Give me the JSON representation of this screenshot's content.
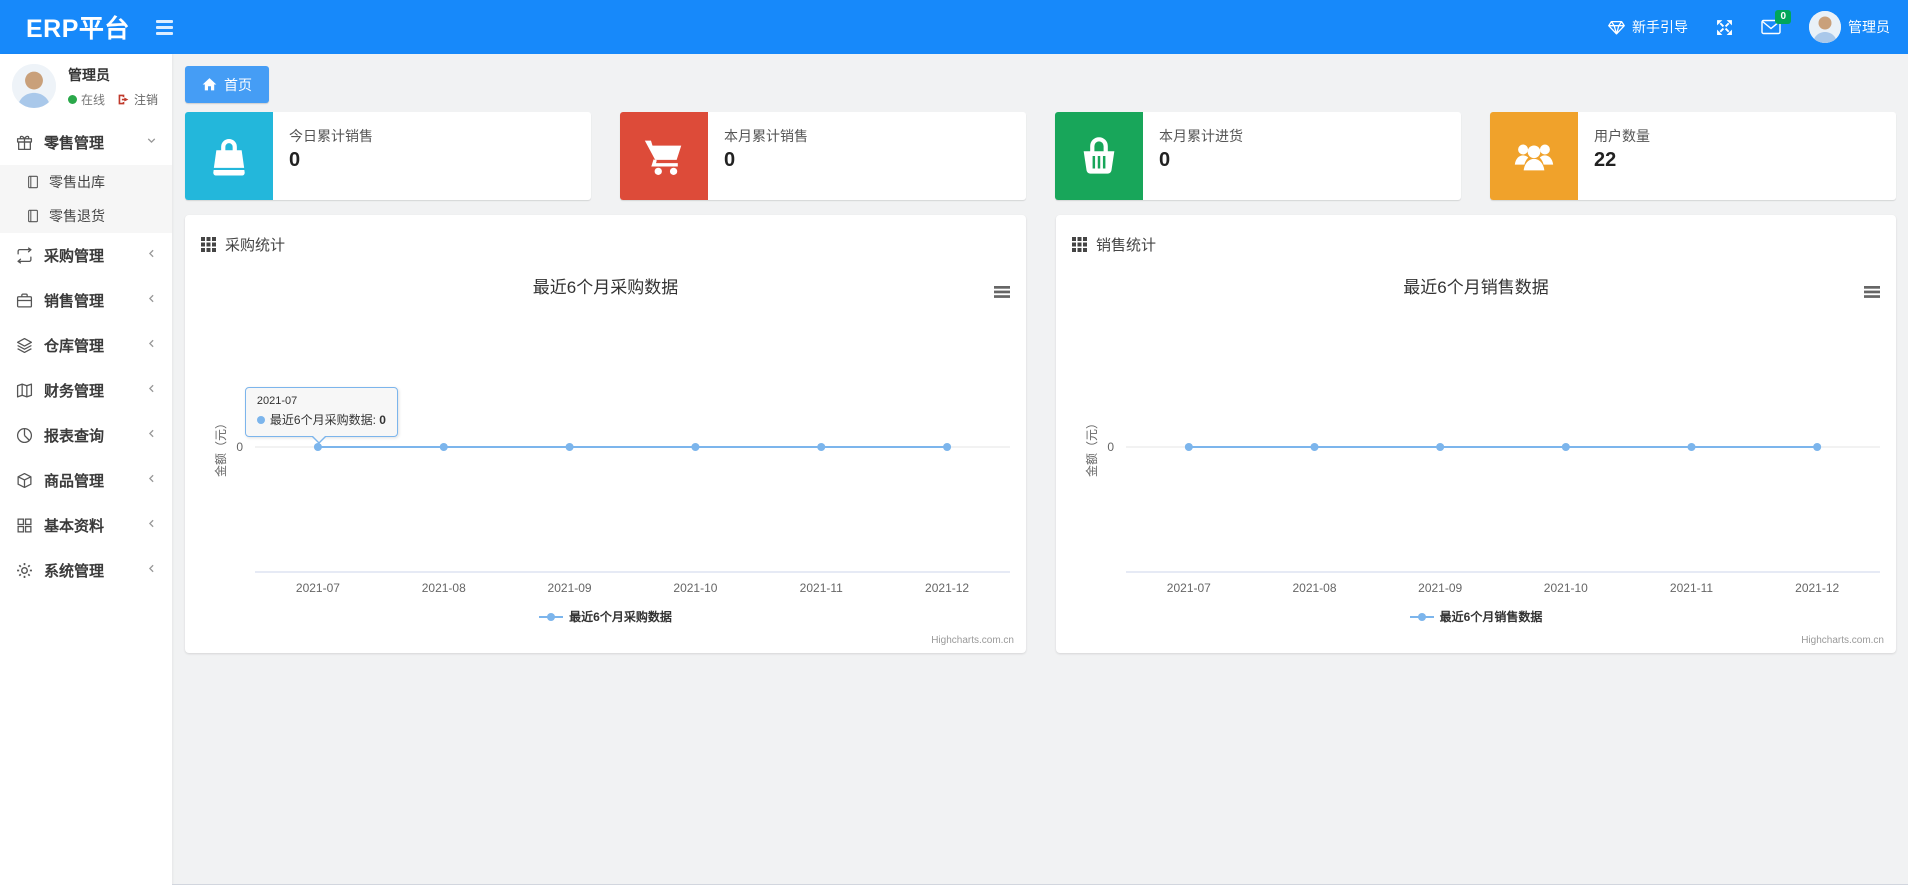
{
  "navbar": {
    "brand": "ERP平台",
    "guide_label": "新手引导",
    "mail_badge": "0",
    "user_label": "管理员",
    "icons": [
      "menu-icon",
      "gem-icon",
      "fullscreen-icon",
      "envelope-icon",
      "avatar"
    ]
  },
  "sidebar": {
    "user": {
      "name": "管理员",
      "status": "在线",
      "logout": "注销"
    },
    "items": [
      {
        "label": "零售管理",
        "icon": "gift-icon",
        "expanded": true,
        "children": [
          {
            "label": "零售出库",
            "icon": "journal-icon"
          },
          {
            "label": "零售退货",
            "icon": "journal-icon"
          }
        ]
      },
      {
        "label": "采购管理",
        "icon": "loop-icon"
      },
      {
        "label": "销售管理",
        "icon": "briefcase-icon"
      },
      {
        "label": "仓库管理",
        "icon": "layers-icon"
      },
      {
        "label": "财务管理",
        "icon": "map-icon"
      },
      {
        "label": "报表查询",
        "icon": "pie-chart-icon"
      },
      {
        "label": "商品管理",
        "icon": "cube-icon"
      },
      {
        "label": "基本资料",
        "icon": "grid-icon"
      },
      {
        "label": "系统管理",
        "icon": "gear-icon"
      }
    ]
  },
  "breadcrumb": {
    "home": "首页"
  },
  "stat_cards": [
    {
      "label": "今日累计销售",
      "value": "0",
      "color": "#23b7db",
      "icon": "bag-icon"
    },
    {
      "label": "本月累计销售",
      "value": "0",
      "color": "#dd4b39",
      "icon": "cart-icon"
    },
    {
      "label": "本月累计进货",
      "value": "0",
      "color": "#18a65a",
      "icon": "basket-icon"
    },
    {
      "label": "用户数量",
      "value": "22",
      "color": "#f0a22b",
      "icon": "users-icon"
    }
  ],
  "panels": [
    {
      "header": "采购统计"
    },
    {
      "header": "销售统计"
    }
  ],
  "chart_data": [
    {
      "type": "line",
      "title": "最近6个月采购数据",
      "categories": [
        "2021-07",
        "2021-08",
        "2021-09",
        "2021-10",
        "2021-11",
        "2021-12"
      ],
      "series": [
        {
          "name": "最近6个月采购数据",
          "values": [
            0,
            0,
            0,
            0,
            0,
            0
          ],
          "color": "#7cb5ec"
        }
      ],
      "xlabel": "",
      "ylabel": "金额（元）",
      "yticks": [
        "0"
      ],
      "ylim": [
        0,
        0
      ],
      "grid": true,
      "legend_position": "bottom",
      "credits": "Highcharts.com.cn",
      "tooltip": {
        "header": "2021-07",
        "series": "最近6个月采购数据",
        "value": "0",
        "point_index": 0
      }
    },
    {
      "type": "line",
      "title": "最近6个月销售数据",
      "categories": [
        "2021-07",
        "2021-08",
        "2021-09",
        "2021-10",
        "2021-11",
        "2021-12"
      ],
      "series": [
        {
          "name": "最近6个月销售数据",
          "values": [
            0,
            0,
            0,
            0,
            0,
            0
          ],
          "color": "#7cb5ec"
        }
      ],
      "xlabel": "",
      "ylabel": "金额（元）",
      "yticks": [
        "0"
      ],
      "ylim": [
        0,
        0
      ],
      "grid": true,
      "legend_position": "bottom",
      "credits": "Highcharts.com.cn"
    }
  ]
}
